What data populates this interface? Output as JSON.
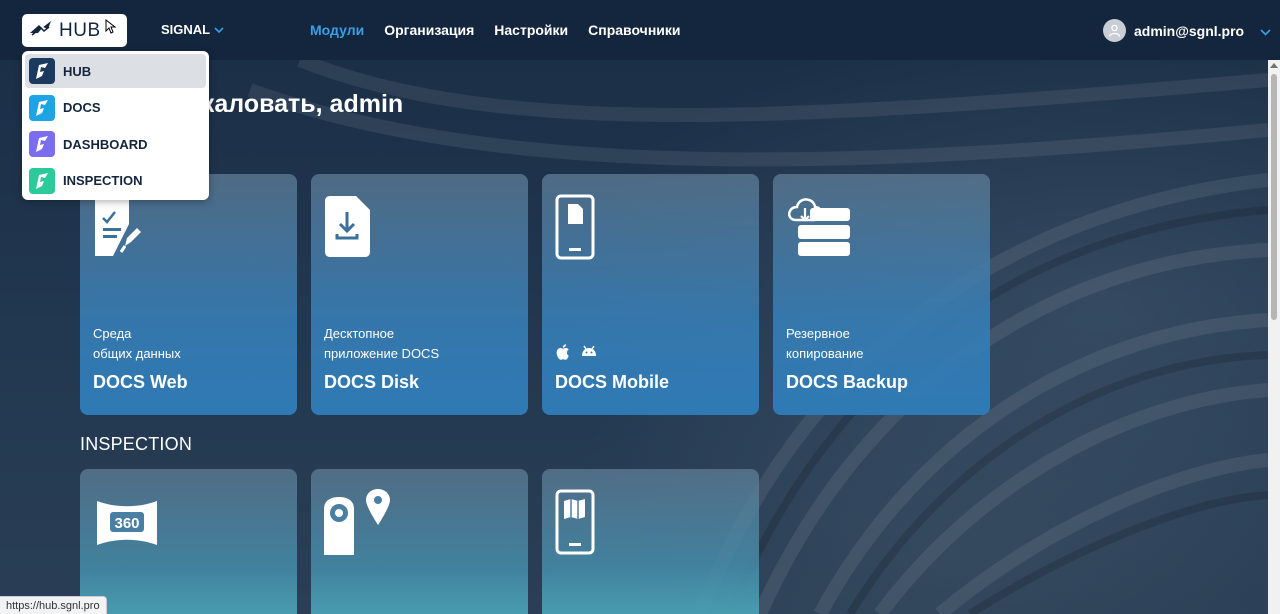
{
  "header": {
    "hub_label": "HUB",
    "org_label": "SIGNAL",
    "nav": [
      {
        "label": "Модули",
        "active": true
      },
      {
        "label": "Организация",
        "active": false
      },
      {
        "label": "Настройки",
        "active": false
      },
      {
        "label": "Справочники",
        "active": false
      }
    ],
    "user_email": "admin@sgnl.pro"
  },
  "greeting": "Добро пожаловать, admin",
  "dropdown": {
    "items": [
      {
        "label": "HUB",
        "color": "#1c3a5e",
        "selected": true
      },
      {
        "label": "DOCS",
        "color": "#1ea3e6",
        "selected": false
      },
      {
        "label": "DASHBOARD",
        "color": "#7b6cf0",
        "selected": false
      },
      {
        "label": "INSPECTION",
        "color": "#2cc99a",
        "selected": false
      }
    ]
  },
  "docs_cards": [
    {
      "sub1": "Среда",
      "sub2": "общих данных",
      "name": "DOCS Web",
      "icon": "document-edit-icon"
    },
    {
      "sub1": "Десктопное",
      "sub2": "приложение DOCS",
      "name": "DOCS Disk",
      "icon": "download-file-icon"
    },
    {
      "sub1": "",
      "sub2": "",
      "name": "DOCS Mobile",
      "icon": "mobile-document-icon"
    },
    {
      "sub1": "Резервное",
      "sub2": "копирование",
      "name": "DOCS Backup",
      "icon": "cloud-backup-icon"
    }
  ],
  "inspection": {
    "title": "INSPECTION",
    "cards": [
      {
        "icon": "panorama-360-icon"
      },
      {
        "icon": "camera-location-icon"
      },
      {
        "icon": "mobile-map-icon"
      }
    ]
  },
  "status_url": "https://hub.sgnl.pro",
  "colors": {
    "header_bg": "#14263d",
    "accent": "#3aa0e6"
  }
}
